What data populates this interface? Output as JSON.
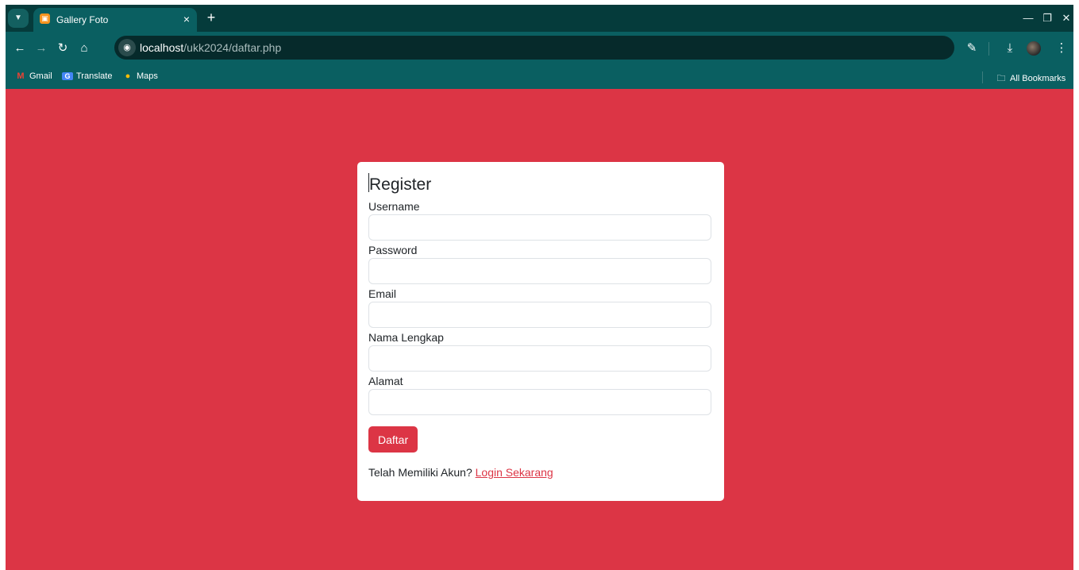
{
  "browser": {
    "tab": {
      "title": "Gallery Foto",
      "close_icon": "×",
      "favicon": "xampp-icon"
    },
    "new_tab_label": "+",
    "url": {
      "host": "localhost",
      "path": "/ukk2024/daftar.php"
    },
    "bookmarks": [
      {
        "label": "Gmail",
        "icon": "gmail-icon",
        "glyph": "M",
        "color": "#ea4335"
      },
      {
        "label": "Translate",
        "icon": "translate-icon",
        "glyph": "G",
        "color": "#4285f4"
      },
      {
        "label": "Maps",
        "icon": "maps-icon",
        "glyph": "●",
        "color": "#34a853"
      }
    ],
    "all_bookmarks_label": "All Bookmarks",
    "colors": {
      "tabbar": "#053b3b",
      "toolbar": "#0a5f61",
      "omnibox": "#062a2b"
    }
  },
  "page": {
    "background": "#dc3545",
    "form": {
      "title": "Register",
      "fields": [
        {
          "label": "Username",
          "value": "",
          "type": "text"
        },
        {
          "label": "Password",
          "value": "",
          "type": "password"
        },
        {
          "label": "Email",
          "value": "",
          "type": "email"
        },
        {
          "label": "Nama Lengkap",
          "value": "",
          "type": "text"
        },
        {
          "label": "Alamat",
          "value": "",
          "type": "text"
        }
      ],
      "submit_label": "Daftar",
      "login_prompt": "Telah Memiliki Akun?",
      "login_link": "Login Sekarang",
      "accent": "#dc3545"
    }
  }
}
